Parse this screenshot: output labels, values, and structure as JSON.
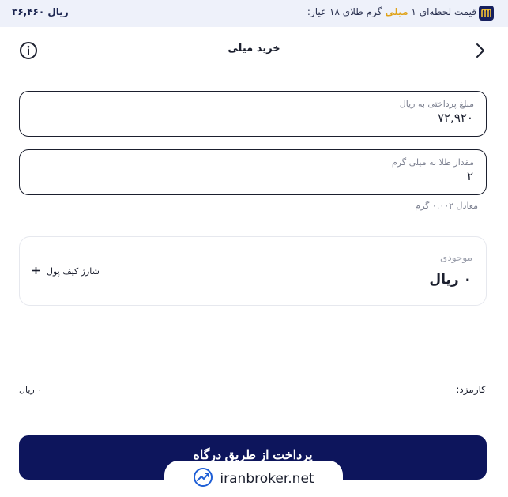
{
  "price_bar": {
    "price": "۳۶,۴۶۰ ریال",
    "text_before": "قیمت لحظه‌ای ۱ ",
    "text_highlight": "میلی",
    "text_after": " گرم طلای ۱۸ عیار:",
    "logo_glyph": "m",
    "highlight_color": "#e0a31a"
  },
  "header": {
    "title": "خرید میلی"
  },
  "amount_field": {
    "label": "مبلغ پرداختی به ریال",
    "value": "۷۲,۹۲۰"
  },
  "gold_field": {
    "label": "مقدار طلا به میلی گرم",
    "value": "۲"
  },
  "equivalent": "معادل ۰.۰۰۲ گرم",
  "balance": {
    "label": "موجودی",
    "value": "۰ ریال",
    "topup_label": "شارژ کیف پول"
  },
  "fee": {
    "label": "کارمزد:",
    "value": "۰ ریال"
  },
  "pay_button": {
    "label": "پرداخت از طریق درگاه"
  },
  "watermark": {
    "text": "iranbroker.net"
  },
  "colors": {
    "primary": "#0d155c",
    "topbar_bg": "#eef1fa"
  }
}
